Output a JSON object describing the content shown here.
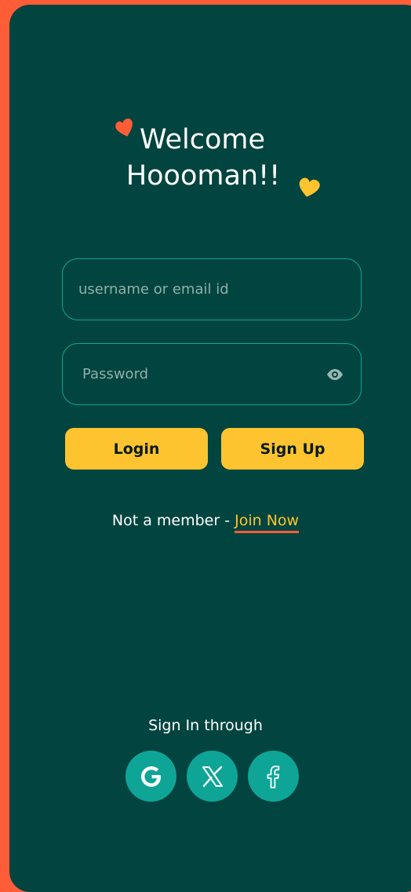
{
  "header": {
    "line1": "Welcome",
    "line2": "Hoooman!!"
  },
  "form": {
    "username_placeholder": "username or email id",
    "password_placeholder": "Password",
    "login_label": "Login",
    "signup_label": "Sign Up"
  },
  "member": {
    "prefix": "Not a member - ",
    "link": "Join Now"
  },
  "social": {
    "label": "Sign In through",
    "providers": [
      {
        "name": "Google",
        "icon": "google-icon"
      },
      {
        "name": "X",
        "icon": "x-icon"
      },
      {
        "name": "Facebook",
        "icon": "facebook-icon"
      }
    ]
  },
  "colors": {
    "background": "#ff5c38",
    "card": "#02443f",
    "accent": "#fec42f",
    "teal": "#0ea597",
    "heart_red": "#ff5c38",
    "heart_yellow": "#fec42f"
  }
}
